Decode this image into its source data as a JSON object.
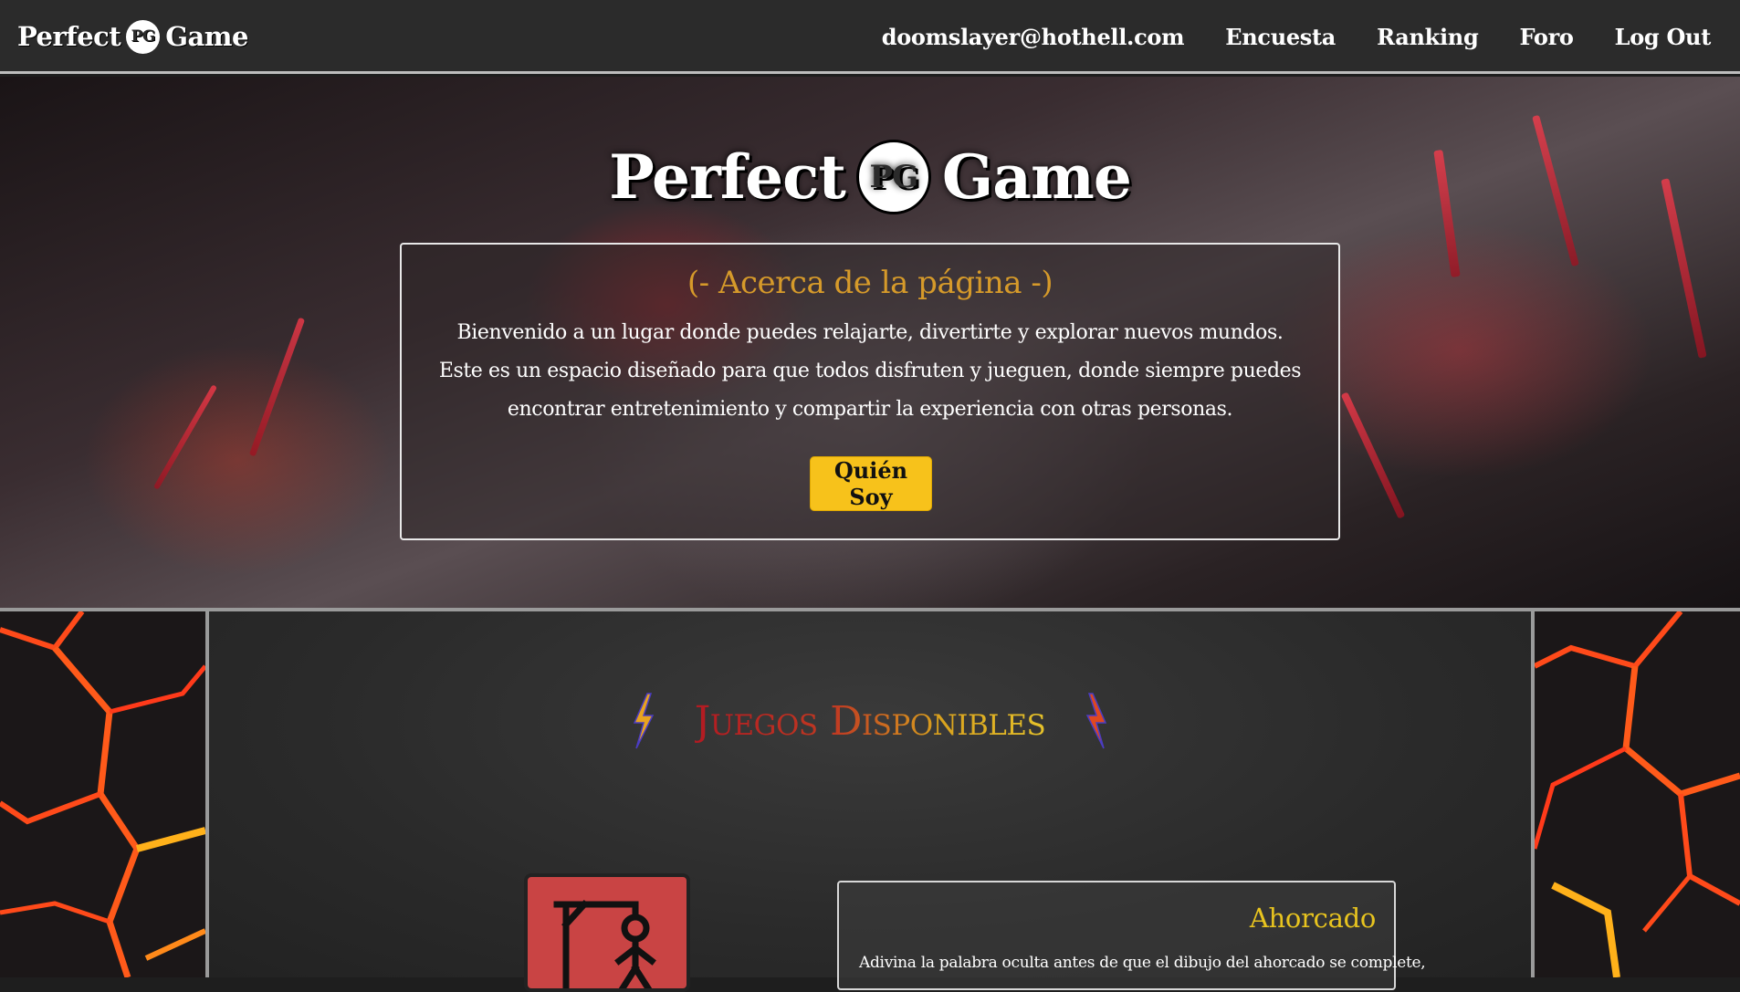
{
  "navbar": {
    "brand_left": "Perfect",
    "brand_mark": "PG",
    "brand_right": "Game",
    "links": [
      {
        "label": "doomslayer@hothell.com"
      },
      {
        "label": "Encuesta"
      },
      {
        "label": "Ranking"
      },
      {
        "label": "Foro"
      },
      {
        "label": "Log Out"
      }
    ]
  },
  "hero": {
    "logo_left": "Perfect",
    "logo_mark": "PG",
    "logo_right": "Game",
    "about_title": "(- Acerca de la página -)",
    "about_text": "Bienvenido a un lugar donde puedes relajarte, divertirte y explorar nuevos mundos. Este es un espacio diseñado para que todos disfruten y jueguen, donde siempre puedes encontrar entretenimiento y compartir la experiencia con otras personas.",
    "button_label": "Quién Soy"
  },
  "games": {
    "title": "Juegos Disponibles",
    "items": [
      {
        "name": "Ahorcado",
        "description": "Adivina la palabra oculta antes de que el dibujo del ahorcado se complete,",
        "icon": "hangman-icon"
      }
    ]
  },
  "colors": {
    "navbar_bg": "#2b2b2b",
    "accent_yellow": "#f7c21b",
    "about_title": "#d69a2a",
    "game_name": "#e8c41f",
    "hangman_card": "#c94444"
  }
}
